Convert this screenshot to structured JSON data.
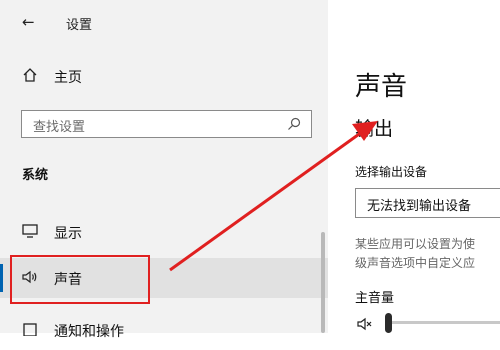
{
  "topbar": {
    "back_glyph": "←",
    "title": "设置"
  },
  "sidebar": {
    "home_label": "主页",
    "search_placeholder": "查找设置",
    "section_title": "系统",
    "items": [
      {
        "label": "显示",
        "icon": "monitor-icon"
      },
      {
        "label": "声音",
        "icon": "speaker-icon",
        "selected": true
      },
      {
        "label": "通知和操作",
        "icon": "notification-icon"
      }
    ]
  },
  "main": {
    "title": "声音",
    "output_title": "输出",
    "choose_device_label": "选择输出设备",
    "device_value": "无法找到输出设备",
    "hint_lines": [
      "某些应用可以设置为使",
      "级声音选项中自定义应"
    ],
    "volume_label": "主音量",
    "volume_icon": "speaker-mute-icon"
  },
  "colors": {
    "accent": "#0063b1",
    "annotation": "#e02020",
    "sidebar_bg": "#f2f2f2"
  }
}
